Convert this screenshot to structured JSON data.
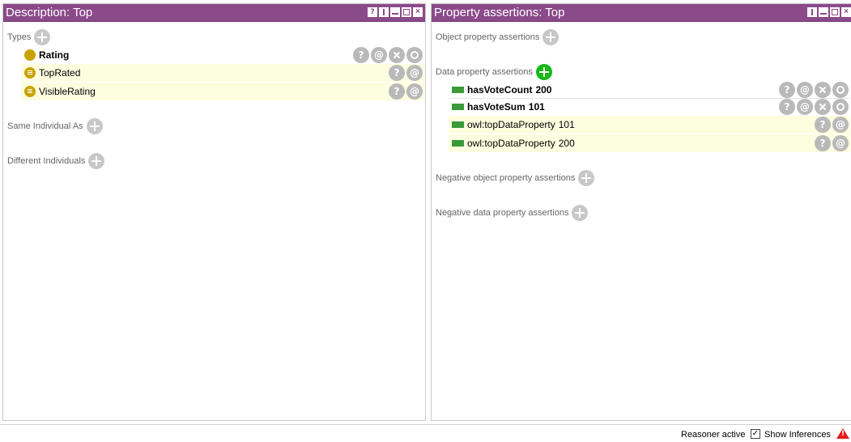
{
  "left_panel": {
    "title": "Description: Top",
    "sections": {
      "types": "Types",
      "same_individual": "Same Individual As",
      "different_individuals": "Different Individuals"
    },
    "types": [
      {
        "label": "Rating",
        "inferred": false
      },
      {
        "label": "TopRated",
        "inferred": true
      },
      {
        "label": "VisibleRating",
        "inferred": true
      }
    ]
  },
  "right_panel": {
    "title": "Property assertions: Top",
    "sections": {
      "object_props": "Object property assertions",
      "data_props": "Data property assertions",
      "neg_object_props": "Negative object property assertions",
      "neg_data_props": "Negative data property assertions"
    },
    "data_assertions": [
      {
        "property": "hasVoteCount",
        "value": "200",
        "inferred": false
      },
      {
        "property": "hasVoteSum",
        "value": "101",
        "inferred": false
      },
      {
        "property": "owl:topDataProperty",
        "value": "101",
        "inferred": true
      },
      {
        "property": "owl:topDataProperty",
        "value": "200",
        "inferred": true
      }
    ]
  },
  "icons": {
    "help": "?",
    "annotate": "@"
  },
  "status": {
    "reasoner": "Reasoner active",
    "show_inferences_label": "Show Inferences",
    "show_inferences_checked": true
  },
  "colors": {
    "titlebar": "#8b4a8a",
    "inferred_row": "#fdfde0",
    "class_icon": "#c8a200",
    "data_property_icon": "#3a9a3a",
    "add_active": "#18b818"
  }
}
